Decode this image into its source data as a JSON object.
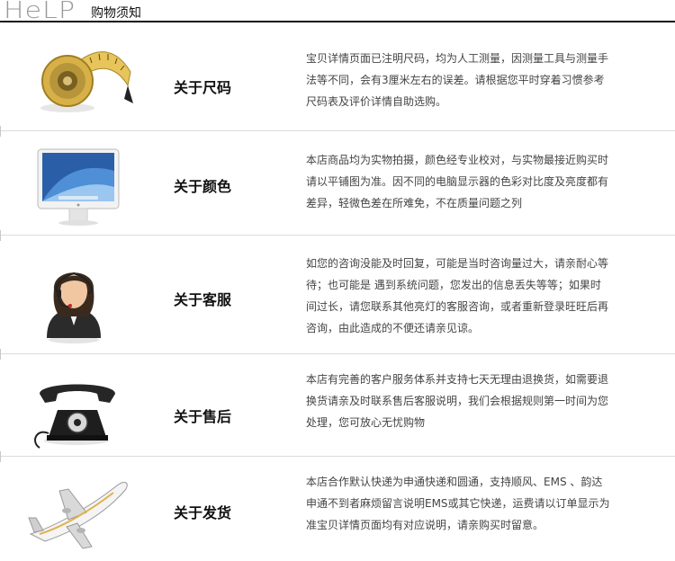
{
  "header": {
    "logo_text": "HeLP",
    "title": "购物须知"
  },
  "rows": [
    {
      "label": "关于尺码",
      "icon": "tape-measure-icon",
      "lines": [
        "宝贝详情页面已注明尺码，均为人工测量，因测量工具与测量手",
        "法等不同，会有3厘米左右的误差。请根据您平时穿着习惯参考",
        "尺码表及评价详情自助选购。"
      ]
    },
    {
      "label": "关于颜色",
      "icon": "monitor-icon",
      "lines": [
        "本店商品均为实物拍摄，颜色经专业校对，与实物最接近购买时",
        "请以平铺图为准。因不同的电脑显示器的色彩对比度及亮度都有",
        "差异，轻微色差在所难免，不在质量问题之列"
      ]
    },
    {
      "label": "关于客服",
      "icon": "customer-service-icon",
      "lines": [
        "如您的咨询没能及时回复，可能是当时咨询量过大，请亲耐心等",
        "待；也可能是  遇到系统问题，您发出的信息丢失等等；如果时",
        "间过长，请您联系其他亮灯的客服咨询，或者重新登录旺旺后再",
        "咨询，由此造成的不便还请亲见谅。"
      ]
    },
    {
      "label": "关于售后",
      "icon": "telephone-icon",
      "lines": [
        "本店有完善的客户服务体系并支持七天无理由退换货，如需要退",
        "换货请亲及时联系售后客服说明，我们会根据规则第一时间为您",
        "处理，您可放心无忧购物"
      ]
    },
    {
      "label": "关于发货",
      "icon": "airplane-icon",
      "lines": [
        "本店合作默认快递为申通快递和圆通，支持顺风、EMS 、韵达",
        "申通不到者麻烦留言说明EMS或其它快递，运费请以订单显示为",
        "准宝贝详情页面均有对应说明，请亲购买时留意。"
      ]
    }
  ]
}
